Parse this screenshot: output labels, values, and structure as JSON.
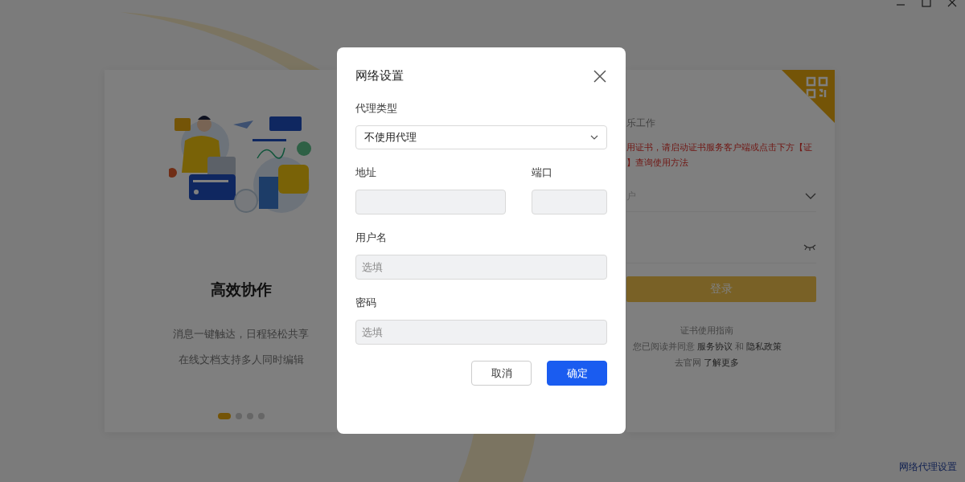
{
  "window_controls": [
    {
      "kind": "minimize"
    },
    {
      "kind": "maximize"
    },
    {
      "kind": "close"
    }
  ],
  "intro_card": {
    "title": "高效协作",
    "lines": [
      "消息一键触达，日程轻松共享",
      "在线文档支持多人同时编辑"
    ],
    "dots": [
      {
        "selected": true
      },
      {
        "selected": false
      },
      {
        "selected": false
      },
      {
        "selected": false
      }
    ]
  },
  "login_card": {
    "subtitle": "乐工作",
    "notice": [
      "用证书，请启动证书服务客户端或点击下方【证",
      "】查询使用方法"
    ],
    "account_placeholder": "户",
    "login_button": "登录",
    "guide_link": "证书使用指南",
    "agreement_prefix": "您已阅读并同意",
    "agreement_links": [
      "服务协议",
      "隐私政策"
    ],
    "agreement_joiner": "和",
    "site_prefix": "去官网",
    "site_link": "了解更多"
  },
  "footer_link": "网络代理设置",
  "dialog": {
    "title": "网络设置",
    "rows": [
      [
        {
          "label": "代理类型",
          "kind": "select",
          "value": "不使用代理"
        }
      ],
      [
        {
          "label": "地址",
          "kind": "text",
          "disabled": true
        },
        {
          "label": "端口",
          "kind": "text",
          "disabled": true
        }
      ],
      [
        {
          "label": "用户名",
          "kind": "text",
          "placeholder": "选填",
          "disabled": true
        }
      ],
      [
        {
          "label": "密码",
          "kind": "text",
          "placeholder": "选填",
          "disabled": true
        }
      ]
    ],
    "buttons": [
      {
        "label": "取消",
        "kind": "secondary"
      },
      {
        "label": "确定",
        "kind": "primary"
      }
    ]
  }
}
